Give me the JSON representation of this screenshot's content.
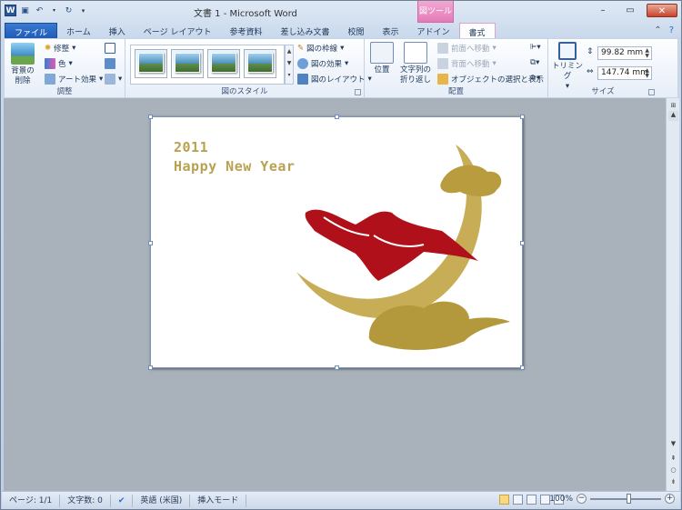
{
  "window": {
    "title": "文書 1 - Microsoft Word",
    "context_tab": "図ツール"
  },
  "tabs": [
    "ファイル",
    "ホーム",
    "挿入",
    "ページ レイアウト",
    "参考資料",
    "差し込み文書",
    "校閲",
    "表示",
    "アドイン",
    "書式"
  ],
  "ribbon": {
    "adjust": {
      "remove_bg": "背景の\n削除",
      "corrections": "修整",
      "color": "色",
      "art_effects": "アート効果",
      "label": "調整"
    },
    "styles": {
      "label": "図のスタイル",
      "border": "図の枠線",
      "effects": "図の効果",
      "layout": "図のレイアウト"
    },
    "arrange": {
      "position": "位置",
      "wrap": "文字列の\n折り返し",
      "bring_forward": "前面へ移動",
      "send_backward": "背面へ移動",
      "selection_pane": "オブジェクトの選択と表示",
      "label": "配置"
    },
    "size": {
      "crop": "トリミング",
      "height": "99.82 mm",
      "width": "147.74 mm",
      "label": "サイズ"
    }
  },
  "card": {
    "year": "2011",
    "greeting": "Happy New Year"
  },
  "status": {
    "page": "ページ: 1/1",
    "words": "文字数: 0",
    "language": "英語 (米国)",
    "mode": "挿入モード",
    "zoom": "100%"
  },
  "colors": {
    "accent_context": "#e47bb8",
    "file_tab": "#1e5bb8",
    "card_gold": "#b8a250",
    "rabbit_red": "#b0101a"
  }
}
